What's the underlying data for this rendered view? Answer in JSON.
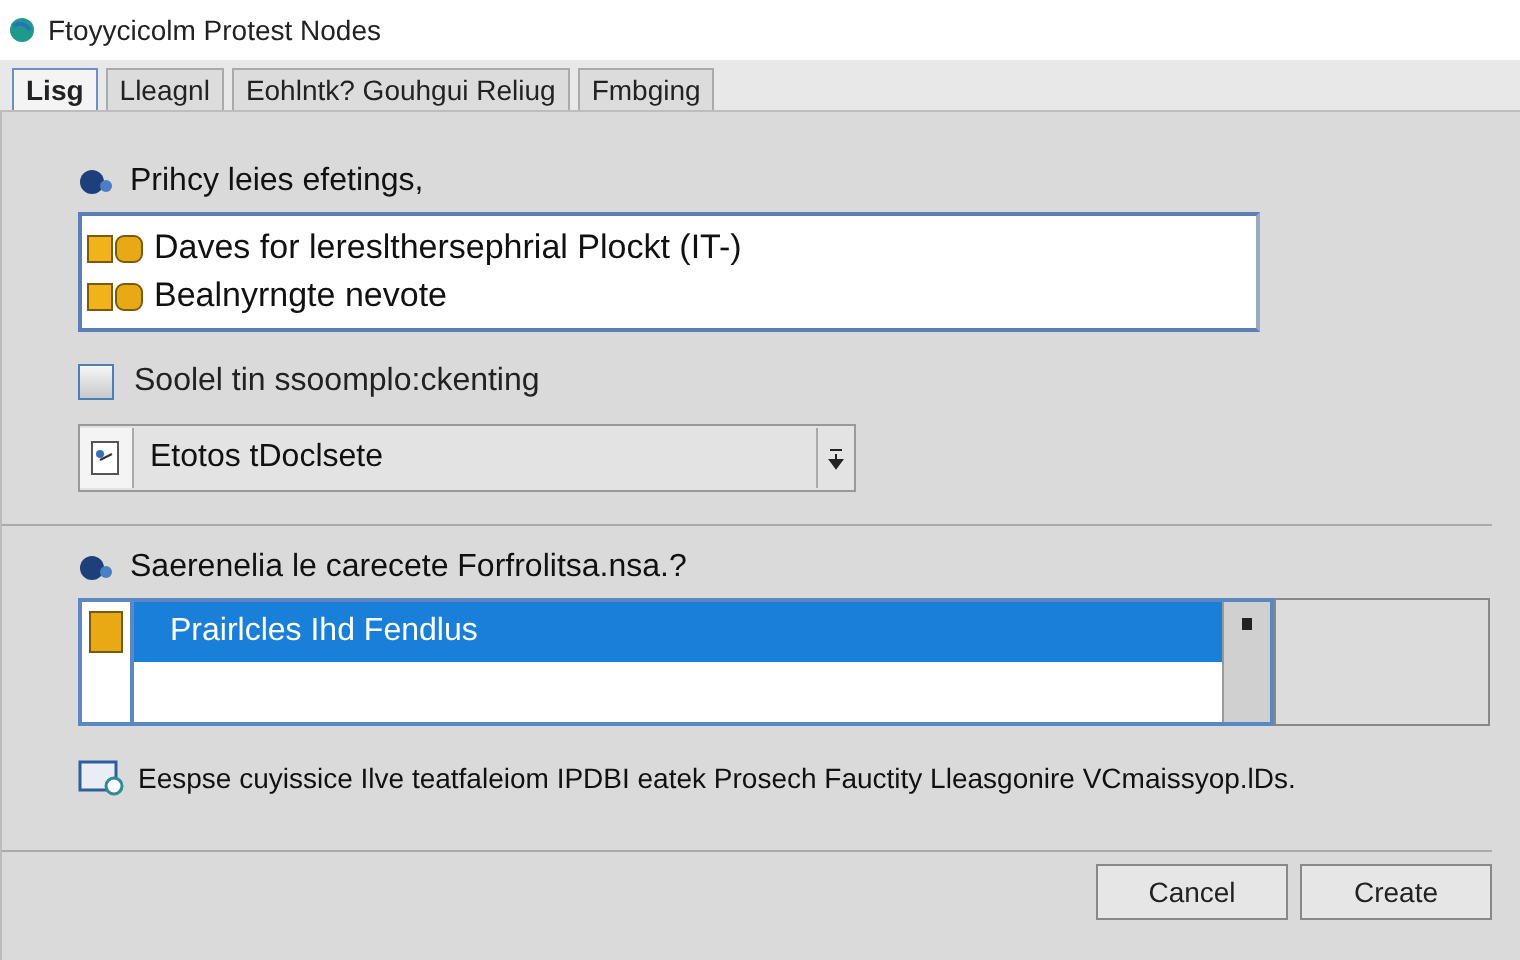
{
  "window": {
    "title": "Ftoyycicolm Protest Nodes"
  },
  "tabs": [
    {
      "label": "Lisg",
      "selected": true
    },
    {
      "label": "Lleagnl",
      "selected": false
    },
    {
      "label": "Eohlntk? Gouhgui Reliug",
      "selected": false
    },
    {
      "label": "Fmbging",
      "selected": false
    }
  ],
  "privacy": {
    "heading": "Prihcy leies efetings,",
    "items": [
      {
        "label": "Daves for lereslthersephrial Plockt (IT-)",
        "selected": false
      },
      {
        "label": "Bealnyrngte nevote",
        "selected": false
      }
    ]
  },
  "checkbox": {
    "label": "Soolel tin ssoomplo:ckenting",
    "checked": false
  },
  "dropdown": {
    "value": "Etotos tDoclsete"
  },
  "section": {
    "heading": "Saerenelia le carecete Forfrolitsa.nsa.?",
    "items": [
      {
        "label": "Prairlcles Ihd Fendlus",
        "selected": true
      },
      {
        "selected": false
      }
    ]
  },
  "info": "Eespse cuyissice Ilve teatfaleiom IPDBI eatek Prosech Fauctity Lleasgonire VCmaissyop.lDs.",
  "buttons": [
    "Cancel",
    "Create"
  ]
}
